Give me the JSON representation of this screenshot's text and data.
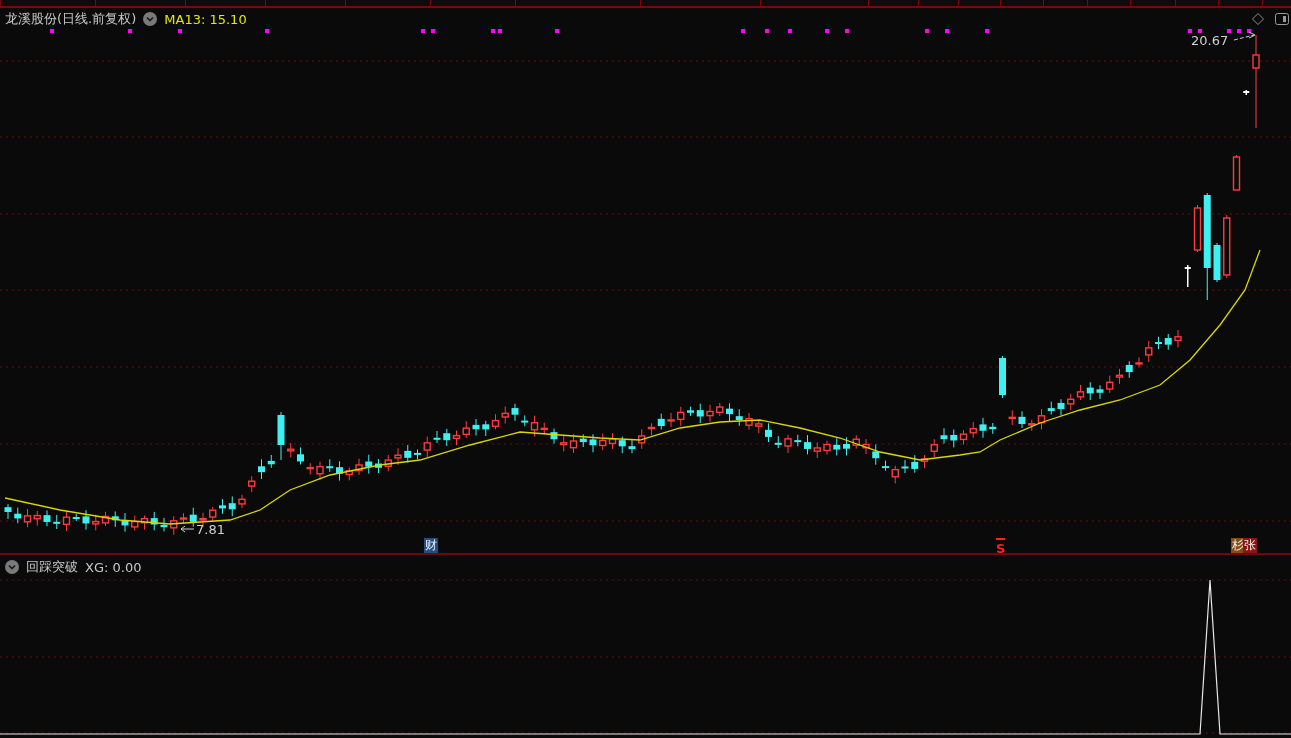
{
  "title": {
    "stock": "龙溪股份(日线.前复权)",
    "indicator": "MA13: 15.10"
  },
  "price_labels": {
    "high": "20.67",
    "low": "7.81"
  },
  "markers": [
    {
      "text": "财",
      "kind": "badge",
      "color": "#1f4f86"
    },
    {
      "text": "S",
      "kind": "signal",
      "color": "#ff2020"
    },
    {
      "text": "杉",
      "kind": "badge",
      "color": "#8a4a12"
    },
    {
      "text": "张",
      "kind": "badge",
      "color": "#8e1414"
    }
  ],
  "lower_panel": {
    "name": "回踩突破",
    "reading": "XG: 0.00"
  }
}
